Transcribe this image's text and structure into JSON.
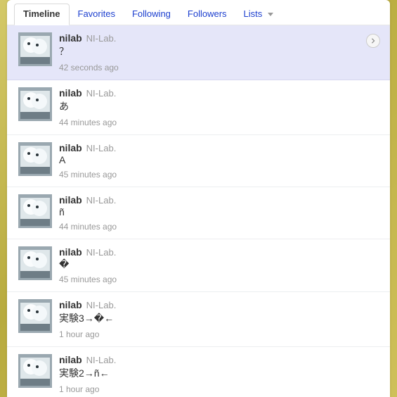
{
  "tabs": [
    {
      "label": "Timeline",
      "active": true,
      "caret": false
    },
    {
      "label": "Favorites",
      "active": false,
      "caret": false
    },
    {
      "label": "Following",
      "active": false,
      "caret": false
    },
    {
      "label": "Followers",
      "active": false,
      "caret": false
    },
    {
      "label": "Lists",
      "active": false,
      "caret": true
    }
  ],
  "tweets": [
    {
      "username": "nilab",
      "fullname": "NI-Lab.",
      "text": "？",
      "time": "42 seconds ago",
      "highlight": true,
      "expand": true
    },
    {
      "username": "nilab",
      "fullname": "NI-Lab.",
      "text": "あ",
      "time": "44 minutes ago",
      "highlight": false,
      "expand": false
    },
    {
      "username": "nilab",
      "fullname": "NI-Lab.",
      "text": "A",
      "time": "45 minutes ago",
      "highlight": false,
      "expand": false
    },
    {
      "username": "nilab",
      "fullname": "NI-Lab.",
      "text": "ñ",
      "time": "44 minutes ago",
      "highlight": false,
      "expand": false
    },
    {
      "username": "nilab",
      "fullname": "NI-Lab.",
      "text": "�",
      "time": "45 minutes ago",
      "highlight": false,
      "expand": false
    },
    {
      "username": "nilab",
      "fullname": "NI-Lab.",
      "text": "実験3→�←",
      "time": "1 hour ago",
      "highlight": false,
      "expand": false
    },
    {
      "username": "nilab",
      "fullname": "NI-Lab.",
      "text": "実験2→ñ←",
      "time": "1 hour ago",
      "highlight": false,
      "expand": false
    }
  ]
}
